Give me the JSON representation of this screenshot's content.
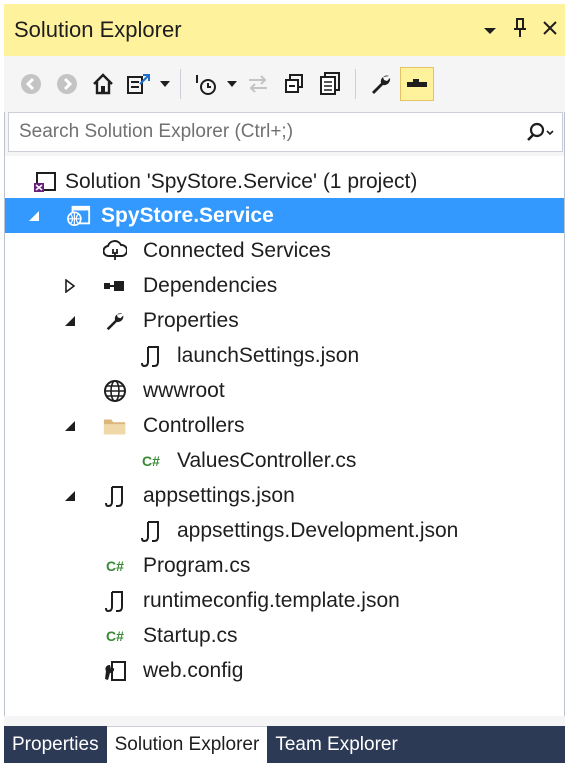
{
  "window": {
    "title": "Solution Explorer",
    "dropdown_glyph": "▾",
    "pin_glyph": "ᚬ",
    "close_glyph": "✕"
  },
  "search": {
    "placeholder": "Search Solution Explorer (Ctrl+;)"
  },
  "tree": {
    "solution": "Solution 'SpyStore.Service' (1 project)",
    "project": "SpyStore.Service",
    "connected_services": "Connected Services",
    "dependencies": "Dependencies",
    "properties": "Properties",
    "launch_settings": "launchSettings.json",
    "wwwroot": "wwwroot",
    "controllers": "Controllers",
    "values_controller": "ValuesController.cs",
    "appsettings": "appsettings.json",
    "appsettings_dev": "appsettings.Development.json",
    "program": "Program.cs",
    "runtimeconfig": "runtimeconfig.template.json",
    "startup": "Startup.cs",
    "webconfig": "web.config",
    "csharp_glyph": "C#"
  },
  "tabs": {
    "properties": "Properties",
    "solution_explorer": "Solution Explorer",
    "team_explorer": "Team Explorer"
  },
  "colors": {
    "title_bg": "#fff29d",
    "selection": "#3399ff",
    "tab_bar": "#2d3a55",
    "csharp_green": "#388a34"
  }
}
